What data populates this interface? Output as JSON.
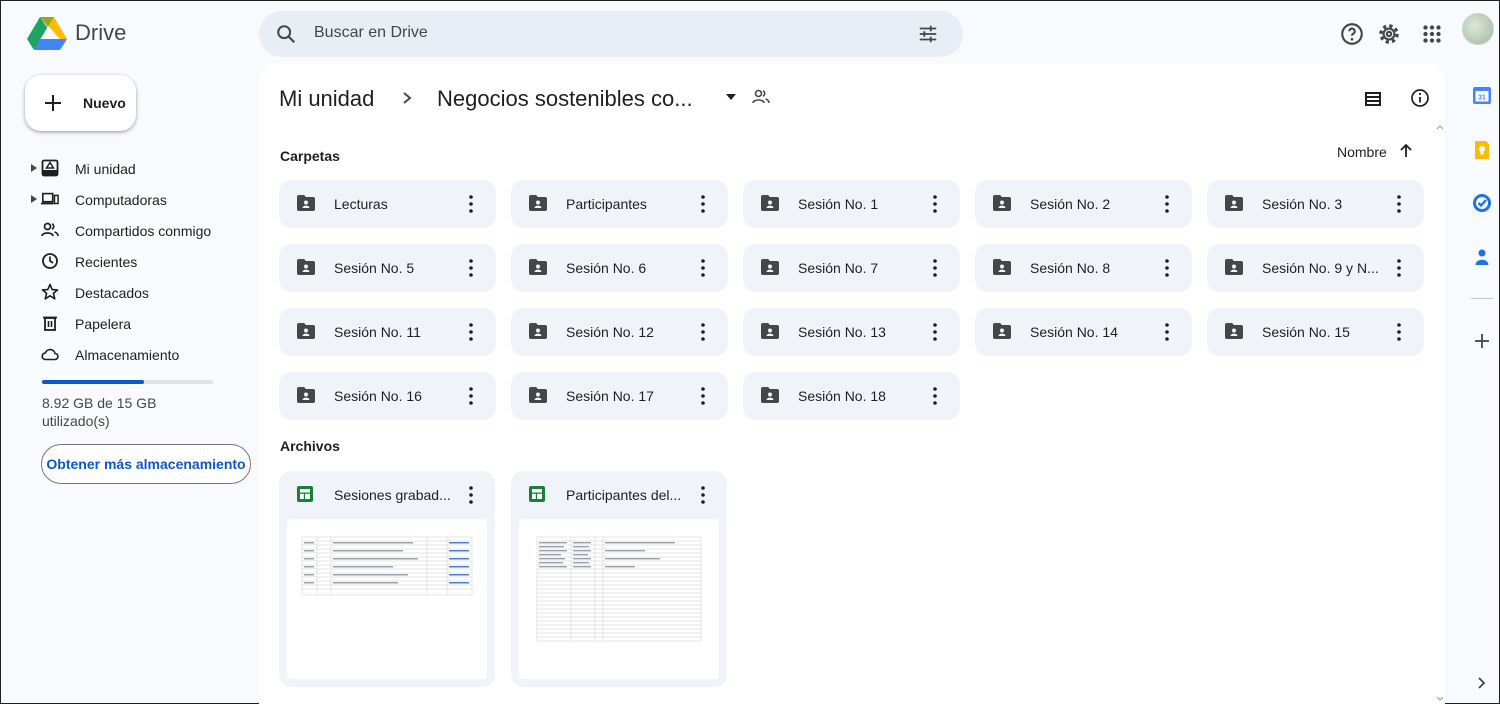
{
  "app": {
    "name": "Drive"
  },
  "search": {
    "placeholder": "Buscar en Drive"
  },
  "nav": {
    "new_label": "Nuevo",
    "items": [
      {
        "label": "Mi unidad",
        "icon": "my-drive-icon",
        "expandable": true
      },
      {
        "label": "Computadoras",
        "icon": "computer-icon",
        "expandable": true
      },
      {
        "label": "Compartidos conmigo",
        "icon": "shared-icon",
        "expandable": false
      },
      {
        "label": "Recientes",
        "icon": "clock-icon",
        "expandable": false
      },
      {
        "label": "Destacados",
        "icon": "star-icon",
        "expandable": false
      },
      {
        "label": "Papelera",
        "icon": "trash-icon",
        "expandable": false
      },
      {
        "label": "Almacenamiento",
        "icon": "cloud-icon",
        "expandable": false
      }
    ],
    "storage": {
      "used_fraction": 0.595,
      "text": "8.92 GB de 15 GB utilizado(s)",
      "button": "Obtener más almacenamiento"
    }
  },
  "breadcrumb": {
    "root": "Mi unidad",
    "current": "Negocios sostenibles co..."
  },
  "sections": {
    "folders_title": "Carpetas",
    "files_title": "Archivos",
    "sort_label": "Nombre"
  },
  "folders": [
    "Lecturas",
    "Participantes",
    "Sesión No. 1",
    "Sesión No. 2",
    "Sesión No. 3",
    "Sesión No. 5",
    "Sesión No. 6",
    "Sesión No. 7",
    "Sesión No. 8",
    "Sesión No. 9 y N...",
    "Sesión No. 11",
    "Sesión No. 12",
    "Sesión No. 13",
    "Sesión No. 14",
    "Sesión No. 15",
    "Sesión No. 16",
    "Sesión No. 17",
    "Sesión No. 18"
  ],
  "files": [
    {
      "name": "Sesiones grabad...",
      "type": "spreadsheet"
    },
    {
      "name": "Participantes del...",
      "type": "spreadsheet"
    }
  ],
  "colors": {
    "accent": "#0b57d0",
    "folder_bg": "#f0f4f9",
    "sheet_green": "#188038",
    "search_bg": "#e9eef6"
  }
}
